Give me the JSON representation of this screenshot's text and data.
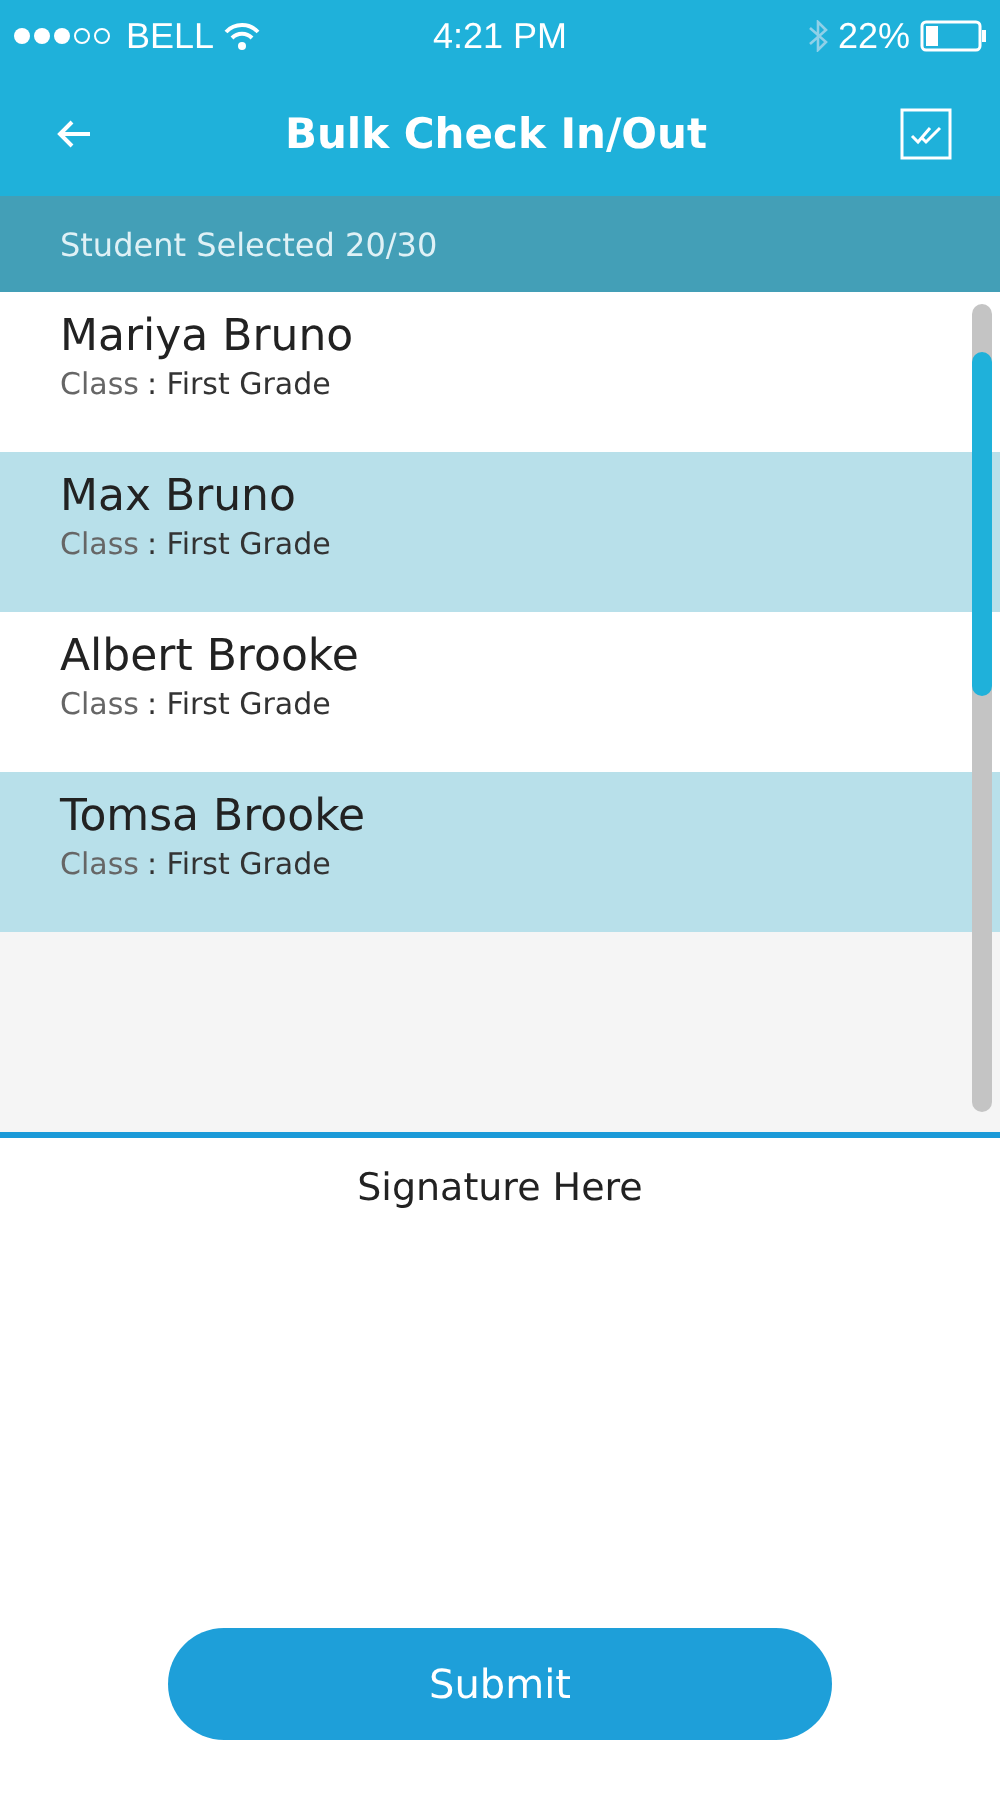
{
  "status_bar": {
    "carrier": "BELL",
    "time": "4:21 PM",
    "battery": "22%"
  },
  "header": {
    "title": "Bulk Check In/Out"
  },
  "selection_bar": {
    "text": "Student Selected 20/30"
  },
  "students": [
    {
      "name": "Mariya Bruno",
      "class_label": "Class",
      "class_value": ": First Grade",
      "selected": false
    },
    {
      "name": "Max Bruno",
      "class_label": "Class",
      "class_value": ": First Grade",
      "selected": true
    },
    {
      "name": "Albert Brooke",
      "class_label": "Class",
      "class_value": ": First Grade",
      "selected": false
    },
    {
      "name": "Tomsa Brooke",
      "class_label": "Class",
      "class_value": ": First Grade",
      "selected": true
    }
  ],
  "signature": {
    "label": "Signature Here"
  },
  "submit_button": {
    "label": "Submit"
  }
}
